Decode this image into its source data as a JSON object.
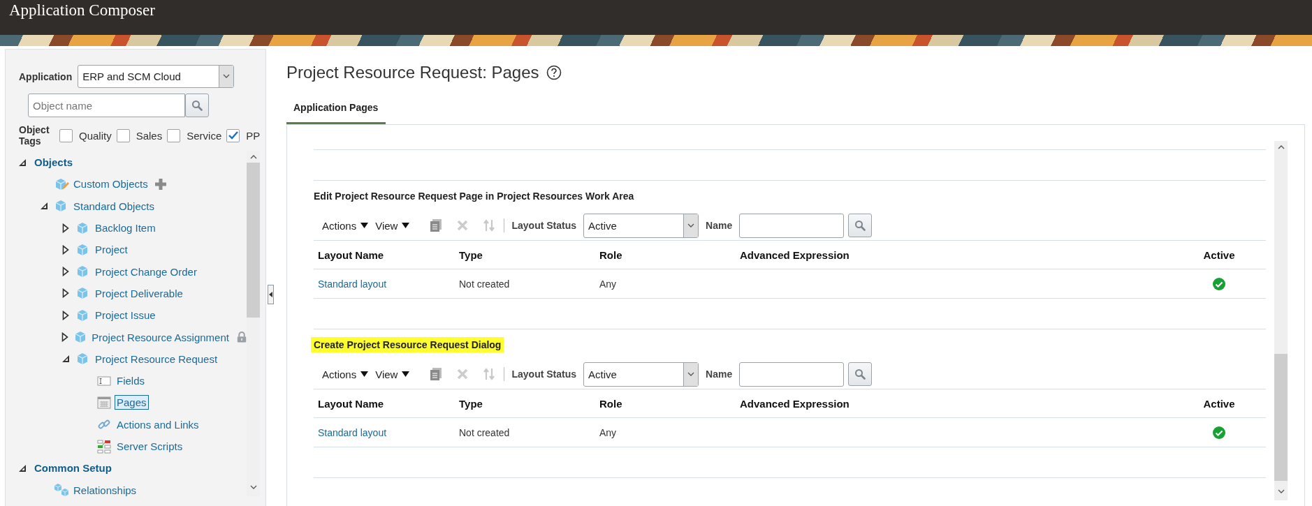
{
  "header": {
    "title": "Application Composer"
  },
  "left_panel": {
    "application_label": "Application",
    "application_value": "ERP and SCM Cloud",
    "search": {
      "placeholder": "Object name"
    },
    "tags_label": "Object Tags",
    "tags": [
      {
        "label": "Quality",
        "checked": false
      },
      {
        "label": "Sales",
        "checked": false
      },
      {
        "label": "Service",
        "checked": false
      },
      {
        "label": "PP",
        "checked": true
      }
    ],
    "tree": [
      {
        "label": "Objects",
        "kind": "category",
        "expanded": true,
        "children": [
          {
            "label": "Custom Objects",
            "kind": "custom-object",
            "add": true
          },
          {
            "label": "Standard Objects",
            "kind": "object",
            "expanded": true,
            "children": [
              {
                "label": "Backlog Item",
                "kind": "object",
                "expanded": false
              },
              {
                "label": "Project",
                "kind": "object",
                "expanded": false
              },
              {
                "label": "Project Change Order",
                "kind": "object",
                "expanded": false
              },
              {
                "label": "Project Deliverable",
                "kind": "object",
                "expanded": false
              },
              {
                "label": "Project Issue",
                "kind": "object",
                "expanded": false
              },
              {
                "label": "Project Resource Assignment",
                "kind": "object",
                "expanded": false,
                "locked": true
              },
              {
                "label": "Project Resource Request",
                "kind": "object",
                "expanded": true,
                "children": [
                  {
                    "label": "Fields",
                    "kind": "fields",
                    "selected": false
                  },
                  {
                    "label": "Pages",
                    "kind": "pages",
                    "selected": true
                  },
                  {
                    "label": "Actions and Links",
                    "kind": "link",
                    "selected": false
                  },
                  {
                    "label": "Server Scripts",
                    "kind": "scripts",
                    "selected": false
                  }
                ]
              }
            ]
          }
        ]
      },
      {
        "label": "Common Setup",
        "kind": "category",
        "expanded": true,
        "children": [
          {
            "label": "Relationships",
            "kind": "relationships"
          }
        ]
      }
    ]
  },
  "main": {
    "title": "Project Resource Request: Pages",
    "tabs": [
      {
        "label": "Application Pages",
        "selected": true
      }
    ],
    "sections": [
      {
        "title": "Edit Project Resource Request Page in Project Resources Work Area",
        "highlighted": false,
        "toolbar": {
          "menus": [
            "Actions",
            "View"
          ],
          "status_label": "Layout Status",
          "status_value": "Active",
          "name_label": "Name"
        },
        "columns": [
          "Layout Name",
          "Type",
          "Role",
          "Advanced Expression",
          "Active"
        ],
        "rows": [
          {
            "layout_name": "Standard layout",
            "type": "Not created",
            "role": "Any",
            "active": true
          }
        ]
      },
      {
        "title": "Create Project Resource Request Dialog",
        "highlighted": true,
        "toolbar": {
          "menus": [
            "Actions",
            "View"
          ],
          "status_label": "Layout Status",
          "status_value": "Active",
          "name_label": "Name"
        },
        "columns": [
          "Layout Name",
          "Type",
          "Role",
          "Advanced Expression",
          "Active"
        ],
        "rows": [
          {
            "layout_name": "Standard layout",
            "type": "Not created",
            "role": "Any",
            "active": true
          }
        ]
      }
    ]
  }
}
